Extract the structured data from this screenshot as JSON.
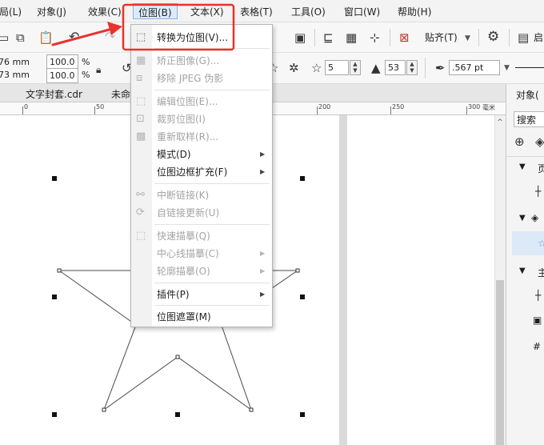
{
  "menubar": {
    "items": [
      "局(L)",
      "对象(J)",
      "效果(C)",
      "位图(B)",
      "文本(X)",
      "表格(T)",
      "工具(O)",
      "窗口(W)",
      "帮助(H)"
    ]
  },
  "toolbar": {
    "snap_label": "贴齐(T)",
    "start_label": "启"
  },
  "propbar": {
    "x_value": "76 mm",
    "y_value": "73 mm",
    "scale_x": "100.0",
    "scale_y": "100.0",
    "percent": "%",
    "points": "5",
    "sharpness": "53",
    "outline_width": ".567 pt"
  },
  "tabs": [
    "文字封套.cdr",
    "未命"
  ],
  "ruler": {
    "labels": [
      "0",
      "50",
      "200",
      "250",
      "300"
    ],
    "unit": "毫米"
  },
  "bitmap_menu": {
    "items": [
      {
        "label": "转换为位图(V)...",
        "enabled": true,
        "icon": "convert-bitmap-icon",
        "submenu": false
      },
      {
        "label": "矫正图像(G)...",
        "enabled": false,
        "icon": "straighten-image-icon",
        "submenu": false
      },
      {
        "label": "移除 JPEG 伪影",
        "enabled": false,
        "icon": "remove-jpeg-artifacts-icon",
        "submenu": false
      },
      {
        "label": "编辑位图(E)...",
        "enabled": false,
        "icon": "edit-bitmap-icon",
        "submenu": false
      },
      {
        "label": "裁剪位图(I)",
        "enabled": false,
        "icon": "crop-bitmap-icon",
        "submenu": false
      },
      {
        "label": "重新取样(R)...",
        "enabled": false,
        "icon": "resample-icon",
        "submenu": false
      },
      {
        "label": "模式(D)",
        "enabled": true,
        "icon": "",
        "submenu": true
      },
      {
        "label": "位图边框扩充(F)",
        "enabled": true,
        "icon": "",
        "submenu": true
      },
      {
        "label": "中断链接(K)",
        "enabled": false,
        "icon": "break-link-icon",
        "submenu": false
      },
      {
        "label": "自链接更新(U)",
        "enabled": false,
        "icon": "update-link-icon",
        "submenu": false
      },
      {
        "label": "快速描摹(Q)",
        "enabled": false,
        "icon": "quick-trace-icon",
        "submenu": false
      },
      {
        "label": "中心线描摹(C)",
        "enabled": false,
        "icon": "",
        "submenu": true
      },
      {
        "label": "轮廓描摹(O)",
        "enabled": false,
        "icon": "",
        "submenu": true
      },
      {
        "label": "插件(P)",
        "enabled": true,
        "icon": "",
        "submenu": true
      },
      {
        "label": "位图遮罩(M)",
        "enabled": true,
        "icon": "",
        "submenu": false
      }
    ]
  },
  "docker": {
    "title": "对象(",
    "search_placeholder": "搜索",
    "row_page_label": "页",
    "row_master_label": "主"
  },
  "annotation": {
    "highlight_color": "#e8322d",
    "arrow_color": "#e8322d"
  }
}
